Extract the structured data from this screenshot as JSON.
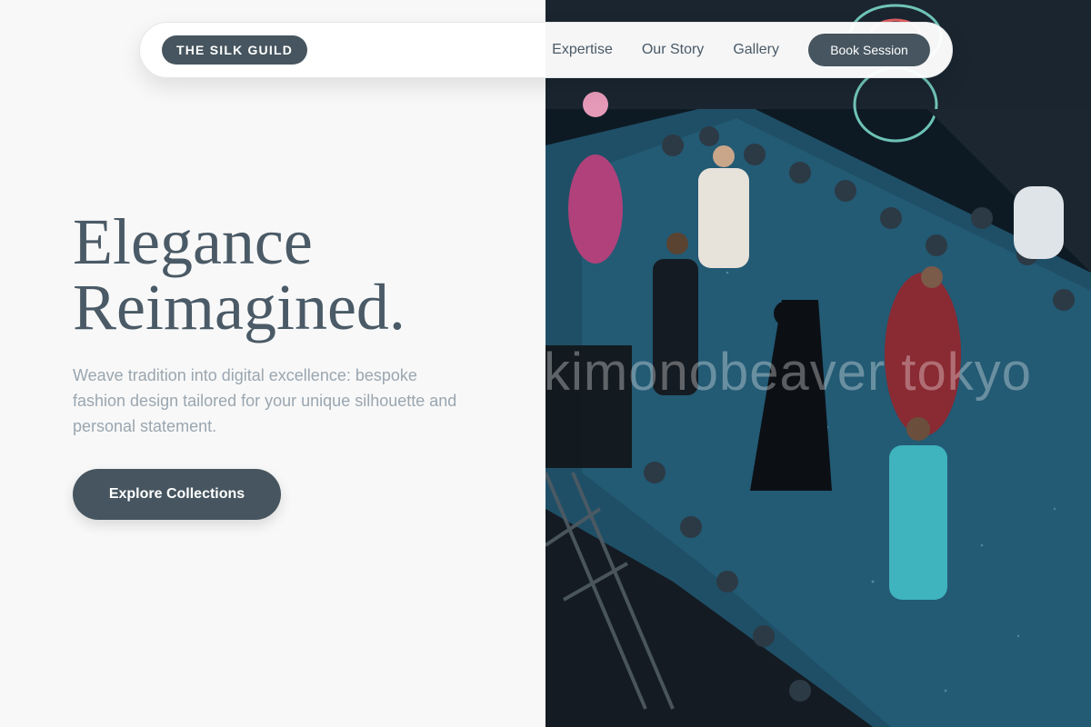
{
  "nav": {
    "brand": "THE SILK GUILD",
    "links": [
      "Expertise",
      "Our Story",
      "Gallery"
    ],
    "cta": "Book Session"
  },
  "hero": {
    "title_line1": "Elegance",
    "title_line2": "Reimagined.",
    "subtitle": "Weave tradition into digital excellence: bespoke fashion design tailored for your unique silhouette and personal statement.",
    "cta": "Explore Collections"
  },
  "photo": {
    "subject": "fashion runway show viewed from above with seated audience",
    "watermark": "kimonobeaver tokyo"
  },
  "colors": {
    "page_bg": "#f8f8f8",
    "accent": "#46555f",
    "heading": "#4a5a66",
    "subtext": "#9aa6b0",
    "runway": "#1f4f66"
  }
}
